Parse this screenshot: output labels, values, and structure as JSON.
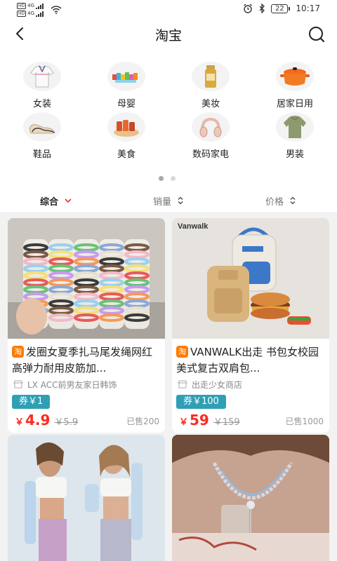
{
  "status_bar": {
    "sim1_label": "HD",
    "sim1_net": "4G",
    "sim2_label": "HD",
    "sim2_net": "4G",
    "battery": "22",
    "time": "10:17"
  },
  "header": {
    "title": "淘宝"
  },
  "categories": [
    {
      "label": "女装",
      "icon": "women-clothing-icon"
    },
    {
      "label": "母婴",
      "icon": "baby-toys-icon"
    },
    {
      "label": "美妆",
      "icon": "cosmetics-icon"
    },
    {
      "label": "居家日用",
      "icon": "home-pot-icon"
    },
    {
      "label": "鞋品",
      "icon": "shoes-icon"
    },
    {
      "label": "美食",
      "icon": "food-icon"
    },
    {
      "label": "数码家电",
      "icon": "headphones-icon"
    },
    {
      "label": "男装",
      "icon": "men-clothing-icon"
    }
  ],
  "pager": {
    "pages": 2,
    "active": 0
  },
  "sort": {
    "comprehensive": "综合",
    "sales": "销量",
    "price": "价格"
  },
  "products": [
    {
      "title": "发圈女夏季扎马尾发绳网红高弹力耐用皮筋加...",
      "badge": "淘",
      "shop": "LX ACC前男友家日韩饰",
      "coupon": "券￥1",
      "currency": "￥",
      "price": "4.9",
      "original_price": "￥5.9",
      "sold": "已售200"
    },
    {
      "title": "VANWALK出走 书包女校园美式复古双肩包...",
      "badge": "淘",
      "shop": "出走少女商店",
      "coupon": "券￥100",
      "currency": "￥",
      "price": "59",
      "original_price": "￥159",
      "sold": "已售1000",
      "brand_text": "Vanwalk"
    },
    {
      "title": "",
      "image": "women-sports-sleeves"
    },
    {
      "title": "",
      "image": "necklace-model"
    }
  ],
  "colors": {
    "accent_red": "#ff2a20",
    "coupon_teal": "#2f9fb5",
    "taobao_orange": "#ff7a00",
    "feed_bg": "#f2f2f2"
  }
}
